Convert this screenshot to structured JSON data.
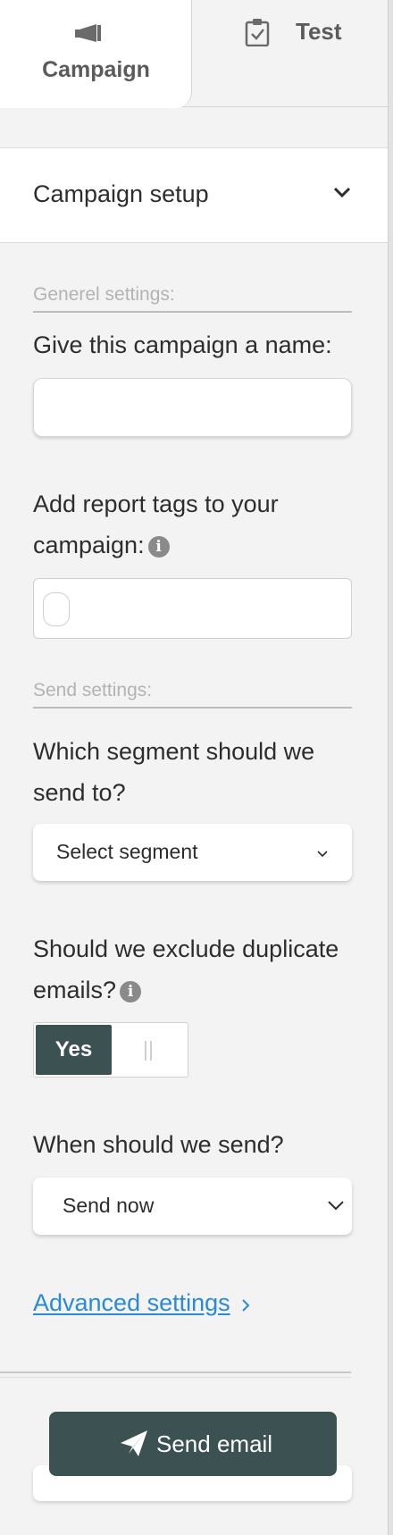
{
  "tabs": [
    {
      "label": "Campaign",
      "icon": "megaphone-icon",
      "active": true
    },
    {
      "label": "Test",
      "icon": "clipboard-check-icon",
      "active": false
    }
  ],
  "accordion": {
    "title": "Campaign setup",
    "icon": "chevron-down-icon"
  },
  "general": {
    "section_label": "Generel settings:",
    "name_label": "Give this campaign a name:",
    "name_value": "",
    "tags_label_line1": "Add report tags to your",
    "tags_label_line2": "campaign:",
    "info_glyph": "i"
  },
  "send": {
    "section_label": "Send settings:",
    "segment_label_line1": "Which segment should we",
    "segment_label_line2": "send to?",
    "segment_value": "Select segment",
    "duplicates_label_line1": "Should we exclude duplicate",
    "duplicates_label_line2": "emails?",
    "duplicates_toggle": {
      "yes_label": "Yes",
      "selected": "yes"
    },
    "when_label": "When should we send?",
    "when_value": "Send now"
  },
  "advanced_link": "Advanced settings",
  "send_button": {
    "label": "Send email",
    "icon": "paper-plane-icon"
  },
  "colors": {
    "primary_dark": "#3c5152",
    "link_blue": "#2a8ad8",
    "background": "#f3f3f3"
  }
}
